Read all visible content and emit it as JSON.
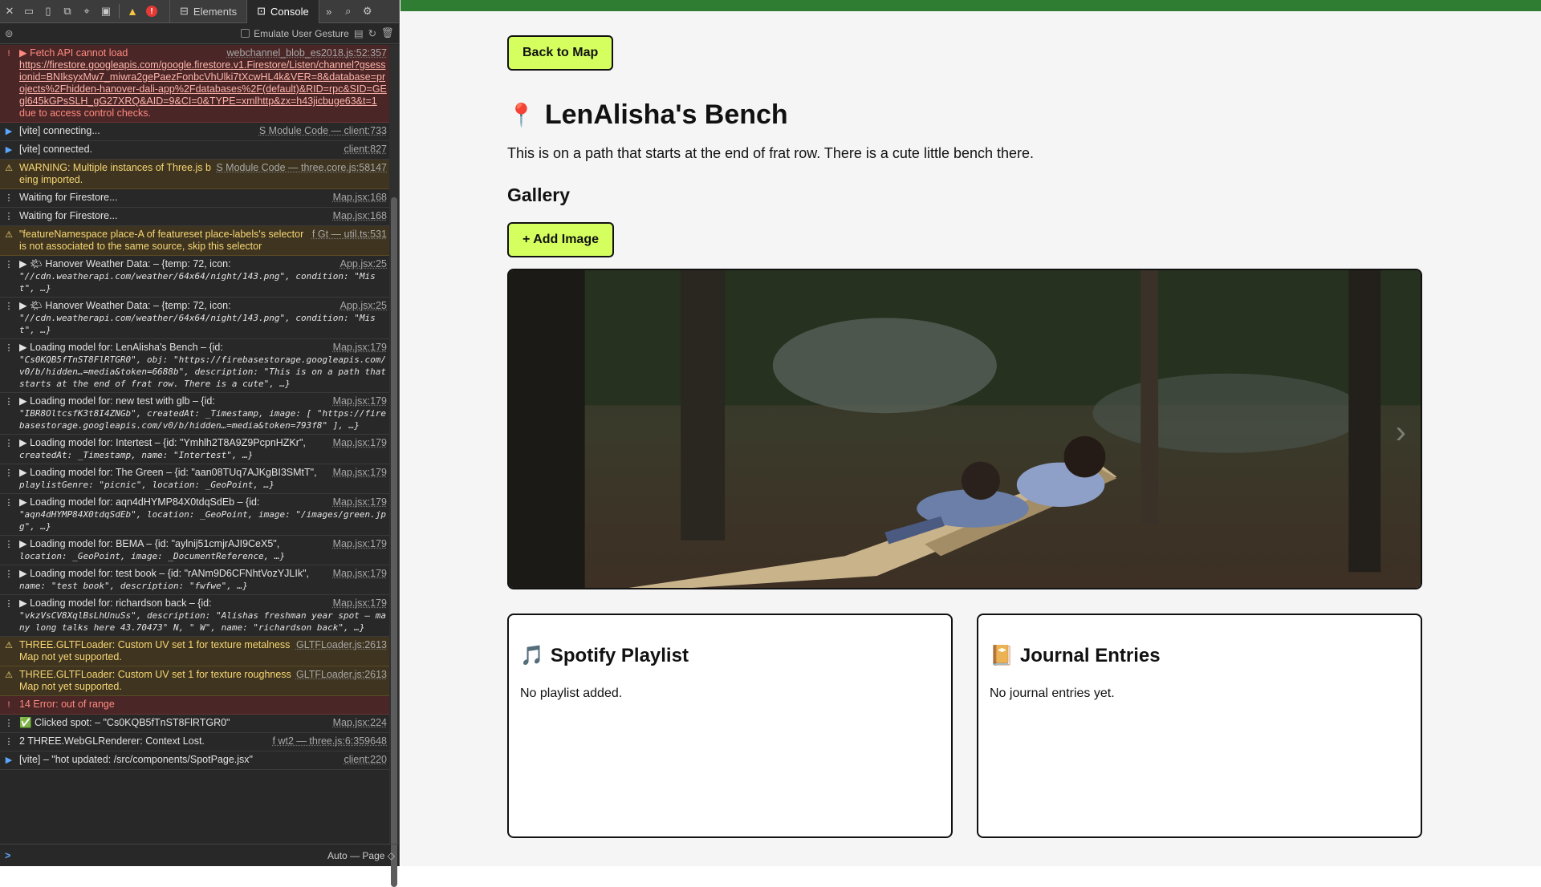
{
  "devtools": {
    "tabs": {
      "elements": "Elements",
      "console": "Console"
    },
    "error_badge": "!",
    "emulate_gesture": "Emulate User Gesture",
    "context": "Auto — Page ◇",
    "prompt": ">",
    "entries": [
      {
        "type": "err",
        "icon": "!",
        "head": "▶ Fetch API cannot load",
        "src": "webchannel_blob_es2018.js:52:357",
        "text": "https://firestore.googleapis.com/google.firestore.v1.Firestore/Listen/channel?gsessionid=BNIksyxMw7_miwra2gePaezFonbcVhUlki7tXcwHL4k&VER=8&database=projects%2Fhidden-hanover-dali-app%2Fdatabases%2F(default)&RID=rpc&SID=GEgl645kGPsSLH_gG27XRQ&AID=9&CI=0&TYPE=xmlhttp&zx=h43jicbuge63&t=1",
        "tail": " due to access control checks."
      },
      {
        "type": "info",
        "icon": "▶",
        "head": "[vite] connecting...",
        "src": "S Module Code — client:733"
      },
      {
        "type": "info",
        "icon": "▶",
        "head": "[vite] connected.",
        "src": "client:827"
      },
      {
        "type": "warn",
        "icon": "⚠",
        "head": "WARNING: Multiple instances of Three.js being imported.",
        "src": "S Module Code — three.core.js:58147"
      },
      {
        "type": "log",
        "icon": "⋮",
        "head": "Waiting for Firestore...",
        "src": "Map.jsx:168"
      },
      {
        "type": "log",
        "icon": "⋮",
        "head": "Waiting for Firestore...",
        "src": "Map.jsx:168"
      },
      {
        "type": "warn",
        "icon": "⚠",
        "head": "\"featureNamespace place-A of featureset place-labels's selector is not associated to the same source, skip this selector",
        "src": "f Gt — util.ts:531"
      },
      {
        "type": "log",
        "icon": "⋮",
        "head": "▶ 🌤 Hanover Weather Data: – {temp: 72, icon:",
        "src": "App.jsx:25",
        "text": "\"//cdn.weatherapi.com/weather/64x64/night/143.png\", condition: \"Mist\", …}"
      },
      {
        "type": "log",
        "icon": "⋮",
        "head": "▶ 🌤 Hanover Weather Data: – {temp: 72, icon:",
        "src": "App.jsx:25",
        "text": "\"//cdn.weatherapi.com/weather/64x64/night/143.png\", condition: \"Mist\", …}"
      },
      {
        "type": "log",
        "icon": "⋮",
        "head": "▶ Loading model for: LenAlisha's Bench – {id:",
        "src": "Map.jsx:179",
        "text": "\"Cs0KQB5fTnST8FlRTGR0\", obj: \"https://firebasestorage.googleapis.com/v0/b/hidden…=media&token=6688b\", description: \"This is on a path that starts at the end of frat row. There is a cute\", …}"
      },
      {
        "type": "log",
        "icon": "⋮",
        "head": "▶ Loading model for: new test with glb – {id:",
        "src": "Map.jsx:179",
        "text": "\"IBR8OltcsfK3t8I4ZNGb\", createdAt: _Timestamp, image: [ \"https://firebasestorage.googleapis.com/v0/b/hidden…=media&token=793f8\" ], …}"
      },
      {
        "type": "log",
        "icon": "⋮",
        "head": "▶ Loading model for: Intertest – {id: \"Ymhlh2T8A9Z9PcpnHZKr\",",
        "src": "Map.jsx:179",
        "text": "createdAt: _Timestamp, name: \"Intertest\", …}"
      },
      {
        "type": "log",
        "icon": "⋮",
        "head": "▶ Loading model for: The Green – {id: \"aan08TUq7AJKgBI3SMtT\",",
        "src": "Map.jsx:179",
        "text": "playlistGenre: \"picnic\", location: _GeoPoint, …}"
      },
      {
        "type": "log",
        "icon": "⋮",
        "head": "▶ Loading model for: aqn4dHYMP84X0tdqSdEb – {id:",
        "src": "Map.jsx:179",
        "text": "\"aqn4dHYMP84X0tdqSdEb\", location: _GeoPoint, image: \"/images/green.jpg\", …}"
      },
      {
        "type": "log",
        "icon": "⋮",
        "head": "▶ Loading model for: BEMA – {id: \"aylnij51cmjrAJI9CeX5\",",
        "src": "Map.jsx:179",
        "text": "location: _GeoPoint, image: _DocumentReference, …}"
      },
      {
        "type": "log",
        "icon": "⋮",
        "head": "▶ Loading model for: test book – {id: \"rANm9D6CFNhtVozYJLIk\",",
        "src": "Map.jsx:179",
        "text": "name: \"test book\", description: \"fwfwe\", …}"
      },
      {
        "type": "log",
        "icon": "⋮",
        "head": "▶ Loading model for: richardson back – {id:",
        "src": "Map.jsx:179",
        "text": "\"vkzVsCV8XqlBsLhUnuSs\", description: \"Alishas freshman year spot – many long talks here 43.70473° N, \" W\", name: \"richardson back\", …}"
      },
      {
        "type": "warn",
        "icon": "⚠",
        "head": "THREE.GLTFLoader: Custom UV set 1 for texture metalnessMap not yet supported.",
        "src": "GLTFLoader.js:2613"
      },
      {
        "type": "warn",
        "icon": "⚠",
        "head": "THREE.GLTFLoader: Custom UV set 1 for texture roughnessMap not yet supported.",
        "src": "GLTFLoader.js:2613"
      },
      {
        "type": "err",
        "icon": "!",
        "head": "14 Error: out of range",
        "src": ""
      },
      {
        "type": "log",
        "icon": "⋮",
        "head": "✅ Clicked spot: – \"Cs0KQB5fTnST8FlRTGR0\"",
        "src": "Map.jsx:224"
      },
      {
        "type": "log",
        "icon": "⋮",
        "head": "2 THREE.WebGLRenderer: Context Lost.",
        "src": "f wt2 — three.js:6:359648"
      },
      {
        "type": "info",
        "icon": "▶",
        "head": "[vite] – \"hot updated: /src/components/SpotPage.jsx\"",
        "src": "client:220"
      }
    ]
  },
  "page": {
    "back_button": "Back to Map",
    "title": "LenAlisha's Bench",
    "description": "This is on a path that starts at the end of frat row. There is a cute little bench there.",
    "gallery_heading": "Gallery",
    "add_image_button": "+ Add Image",
    "next_arrow": "›",
    "spotify": {
      "heading": "Spotify Playlist",
      "empty": "No playlist added."
    },
    "journal": {
      "heading": "Journal Entries",
      "empty": "No journal entries yet."
    }
  },
  "colors": {
    "accent": "#d4ff5e",
    "topbar": "#2e7d32"
  }
}
